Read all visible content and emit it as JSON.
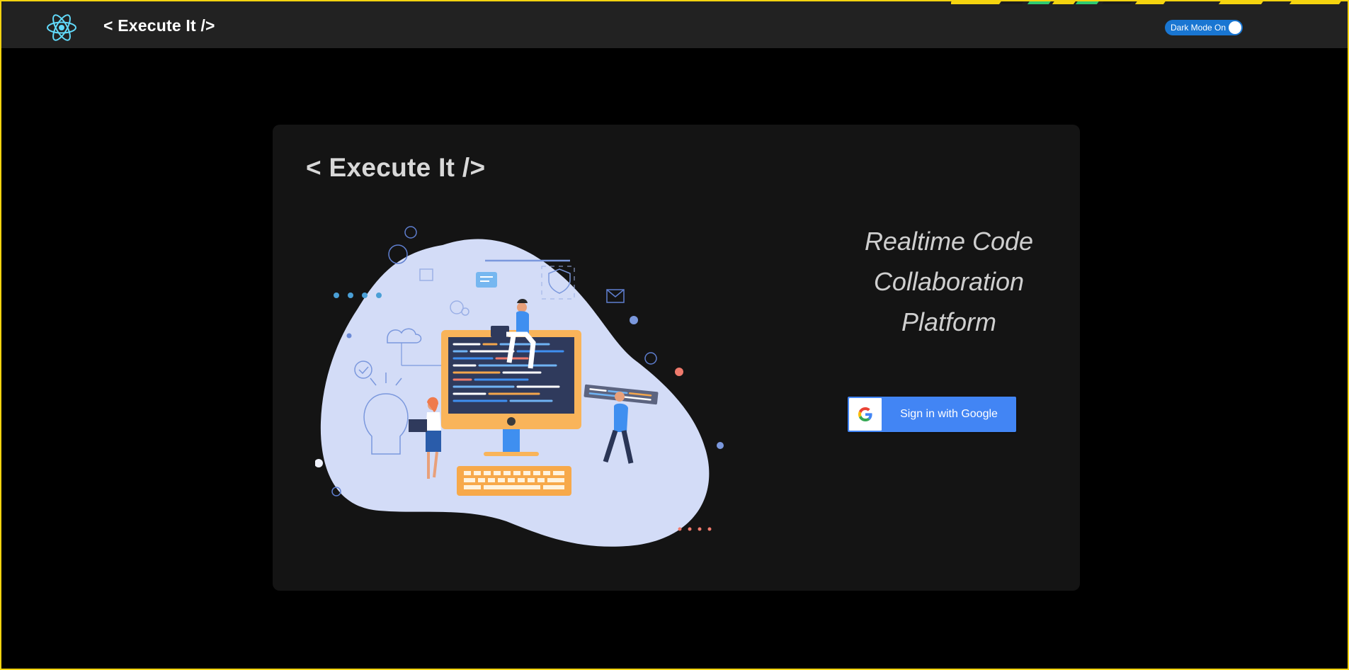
{
  "navbar": {
    "logo_icon": "react-atom-icon",
    "title": "< Execute It />",
    "dark_mode_toggle": {
      "label": "Dark Mode On",
      "state": "on"
    }
  },
  "card": {
    "title": "< Execute It />",
    "illustration": "team-coding-illustration",
    "tagline": [
      "Realtime Code",
      "Collaboration",
      "Platform"
    ],
    "sign_in": {
      "label": "Sign in with Google",
      "icon": "google-g-icon"
    }
  },
  "colors": {
    "background": "#000000",
    "navbar": "#222222",
    "card": "#141414",
    "accent_blue": "#4285f4",
    "toggle_blue": "#1976d2",
    "frame_yellow": "#f5d40f",
    "blob": "#d3dcf7"
  }
}
